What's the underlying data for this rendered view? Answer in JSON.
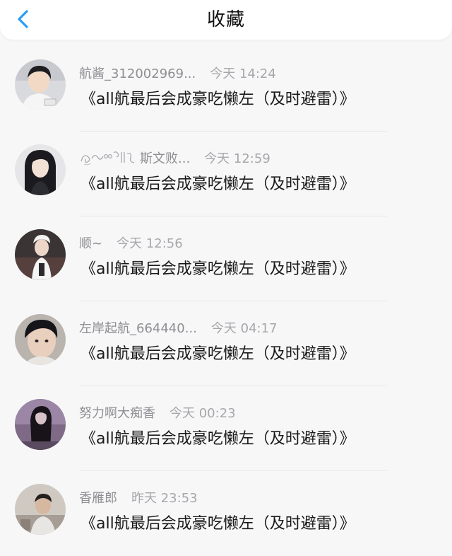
{
  "header": {
    "title": "收藏",
    "accent_color": "#2a9df4"
  },
  "favorites": [
    {
      "name": "航酱_312002969...",
      "time": "今天 14:24",
      "book_title": "《all航最后会成豪吃懒左（及时避雷）》",
      "avatar_icon": "boy-portrait"
    },
    {
      "name": "斯文败...",
      "time": "今天 12:59",
      "book_title": "《all航最后会成豪吃懒左（及时避雷）》",
      "avatar_icon": "girl-portrait"
    },
    {
      "name": "顺~",
      "time": "今天 12:56",
      "book_title": "《all航最后会成豪吃懒左（及时避雷）》",
      "avatar_icon": "boy-cap-portrait"
    },
    {
      "name": "左岸起航_664440...",
      "time": "今天 04:17",
      "book_title": "《all航最后会成豪吃懒左（及时避雷）》",
      "avatar_icon": "boy-closeup-portrait"
    },
    {
      "name": "努力啊大痴香",
      "time": "今天 00:23",
      "book_title": "《all航最后会成豪吃懒左（及时避雷）》",
      "avatar_icon": "dark-hair-figure"
    },
    {
      "name": "香雁郎",
      "time": "昨天 23:53",
      "book_title": "《all航最后会成豪吃懒左（及时避雷）》",
      "avatar_icon": "person-photo"
    }
  ]
}
